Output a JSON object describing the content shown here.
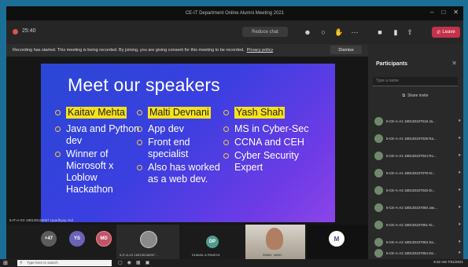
{
  "window": {
    "title": "CE-IT Department Online Alumni Meeting 2021",
    "controls": [
      "–",
      "□",
      "✕"
    ]
  },
  "toolbar": {
    "timer": "25:40",
    "pill_label": "Reduce chat",
    "icons": [
      "people-icon",
      "chat-icon",
      "raise-hand-icon",
      "more-icon",
      "camera-icon",
      "mic-icon",
      "share-icon"
    ],
    "leave_label": "Leave"
  },
  "banner": {
    "text": "Recording has started. This meeting is being recorded. By joining, you are giving consent for this meeting to be recorded.",
    "link": "Privacy policy",
    "dismiss": "Dismiss"
  },
  "slide": {
    "title": "Meet our speakers",
    "columns": [
      {
        "name": "Kaitav Mehta",
        "items": [
          "Java and Python dev",
          "Winner of Microsoft x Loblow Hackathon"
        ]
      },
      {
        "name": "Malti Devnani",
        "items": [
          "App dev",
          "Front end specialist",
          "Also has worked as a web dev."
        ]
      },
      {
        "name": "Yash Shah",
        "items": [
          "MS in Cyber-Sec",
          "CCNA and CEH",
          "Cyber Security Expert"
        ]
      }
    ],
    "caption": "5-IT-A-XX 180130116057 Upadhyay Atul"
  },
  "thumbs": [
    {
      "initials": "+47",
      "color": "#5c5c5c"
    },
    {
      "initials": "YS",
      "color": "#6b63b6"
    },
    {
      "initials": "MD",
      "color": "#c0546a"
    },
    {
      "label": "5-IT-A-XX 180130116057 ..."
    },
    {
      "initials": "DP",
      "color": "#4f9b8e",
      "label": "DHAVAL A PANDYA"
    },
    {
      "label": "SHAH, YASH"
    },
    {
      "initials": "M"
    }
  ],
  "participants": {
    "header": "Participants",
    "search_placeholder": "Type a name",
    "share_invite": "Share invite",
    "list": [
      "5-CE-A-A1 180130107018 Ja...",
      "5-CE-A-A1 180130107029 Ra...",
      "5-CE-A-A1 180130107044 Ro...",
      "5-CE-A-A1 180130107079 Ni...",
      "5-CE-A-A2 180130107045 Di...",
      "5-CE-A-A2 180130107050 Jas...",
      "5-CE-A-A2 180130107051 Ni...",
      "5-CE-A-A2 180130107053 Sa...",
      "5-CE-A-A2 180130107054 De..."
    ]
  },
  "taskbar": {
    "search_placeholder": "Type here to search",
    "time": "9:32 AM",
    "date": "7/31/2021"
  }
}
